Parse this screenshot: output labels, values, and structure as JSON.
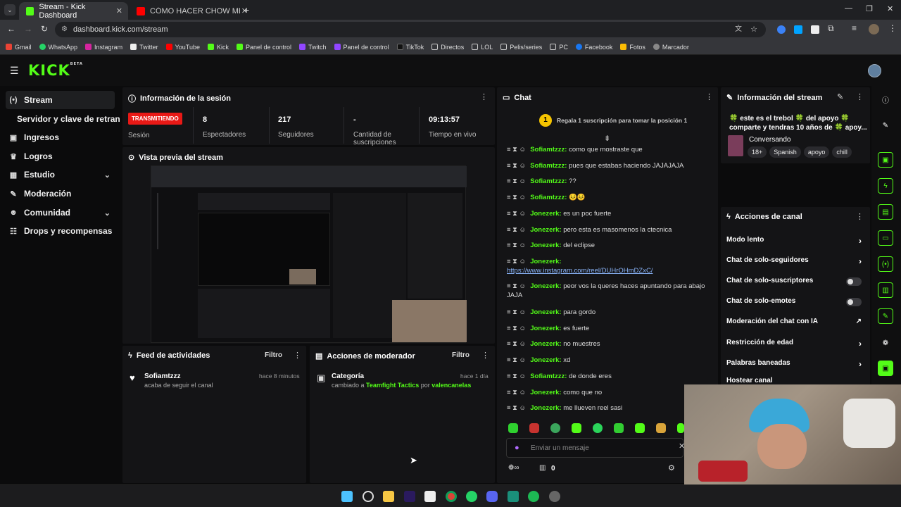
{
  "browser": {
    "tabs": [
      {
        "title": "Stream - Kick Dashboard"
      },
      {
        "title": "CÓMO HACER CHOW MEIN: LO"
      }
    ],
    "url": "dashboard.kick.com/stream",
    "bookmarks": [
      "Gmail",
      "WhatsApp",
      "Instagram",
      "Twitter",
      "YouTube",
      "Kick",
      "Panel de control",
      "Twitch",
      "Panel de control",
      "TikTok",
      "Directos",
      "LOL",
      "Pelis/series",
      "PC",
      "Facebook",
      "Fotos",
      "Marcador"
    ]
  },
  "app": {
    "logo": "KICK",
    "logo_beta": "BETA",
    "sidebar": [
      {
        "label": "Stream",
        "icon": "broadcast-icon"
      },
      {
        "label": "Servidor y clave de retransm",
        "icon": ""
      },
      {
        "label": "Ingresos",
        "icon": "money-icon"
      },
      {
        "label": "Logros",
        "icon": "trophy-icon"
      },
      {
        "label": "Estudio",
        "icon": "studio-icon"
      },
      {
        "label": "Moderación",
        "icon": "wrench-icon"
      },
      {
        "label": "Comunidad",
        "icon": "people-icon"
      },
      {
        "label": "Drops y recompensas",
        "icon": "gift-icon"
      }
    ],
    "session": {
      "title": "Información de la sesión",
      "live_badge": "TRANSMITIENDO",
      "session_label": "Sesión",
      "stats": [
        {
          "value": "8",
          "label": "Espectadores"
        },
        {
          "value": "217",
          "label": "Seguidores"
        },
        {
          "value": "-",
          "label": "Cantidad de suscripciones"
        },
        {
          "value": "09:13:57",
          "label": "Tiempo en vivo"
        }
      ]
    },
    "preview_title": "Vista previa del stream",
    "feed": {
      "title": "Feed de actividades",
      "filter": "Filtro",
      "item_user": "Sofiamtzzz",
      "item_text": "acaba de seguir el canal",
      "item_time": "hace 8 minutos"
    },
    "mod_actions": {
      "title": "Acciones de moderador",
      "filter": "Filtro",
      "item_title": "Categoría",
      "item_time": "hace 1 día",
      "item_prefix": "cambiado a",
      "item_category": "Teamfight Tactics",
      "item_by": "por",
      "item_user": "valencanelas"
    },
    "chat": {
      "title": "Chat",
      "sub_goal_badge": "1",
      "sub_goal_text": "Regala 1 suscripción para tomar la posición 1",
      "messages": [
        {
          "user": "Sofiamtzzz:",
          "text": "como que mostraste que"
        },
        {
          "user": "Sofiamtzzz:",
          "text": "pues que estabas haciendo JAJAJAJA"
        },
        {
          "user": "Sofiamtzzz:",
          "text": "??"
        },
        {
          "user": "Sofiamtzzz:",
          "text": "😣😣"
        },
        {
          "user": "Jonezerk:",
          "text": "es un poc fuerte"
        },
        {
          "user": "Jonezerk:",
          "text": "pero esta es masomenos la ctecnica"
        },
        {
          "user": "Jonezerk:",
          "text": "del eclipse"
        },
        {
          "user": "Jonezerk:",
          "text": "https://www.instagram.com/reel/DUHrOHmDZxC/"
        },
        {
          "user": "Jonezerk:",
          "text": "peor vos la queres haces apuntando para abajo JAJA"
        },
        {
          "user": "Jonezerk:",
          "text": "para gordo"
        },
        {
          "user": "Jonezerk:",
          "text": "es fuerte"
        },
        {
          "user": "Jonezerk:",
          "text": "no muestres"
        },
        {
          "user": "Jonezerk:",
          "text": "xd"
        },
        {
          "user": "Sofiamtzzz:",
          "text": "de donde eres"
        },
        {
          "user": "Jonezerk:",
          "text": "como que no"
        },
        {
          "user": "Jonezerk:",
          "text": "me llueven reel sasi"
        }
      ],
      "input_placeholder": "Enviar un mensaje",
      "footer_count": "0"
    },
    "stream_info": {
      "title": "Información del stream",
      "line1": "🍀 este es el trebol 🍀 del apoyo 🍀",
      "line2": "comparte y tendras 10 años de 🍀 apoy...",
      "category": "Conversando",
      "tags": [
        "18+",
        "Spanish",
        "apoyo",
        "chill"
      ]
    },
    "channel_actions": {
      "title": "Acciones de canal",
      "items": [
        {
          "label": "Modo lento",
          "control": "arrow"
        },
        {
          "label": "Chat de solo-seguidores",
          "control": "arrow"
        },
        {
          "label": "Chat de solo-suscriptores",
          "control": "toggle"
        },
        {
          "label": "Chat de solo-emotes",
          "control": "toggle"
        },
        {
          "label": "Moderación del chat con IA",
          "control": "external"
        },
        {
          "label": "Restricción de edad",
          "control": "arrow"
        },
        {
          "label": "Palabras baneadas",
          "control": "arrow"
        },
        {
          "label": "Hostear canal",
          "control": "none"
        }
      ]
    }
  },
  "colors": {
    "accent": "#53fc18",
    "live": "#e91916",
    "panel": "#141416"
  }
}
